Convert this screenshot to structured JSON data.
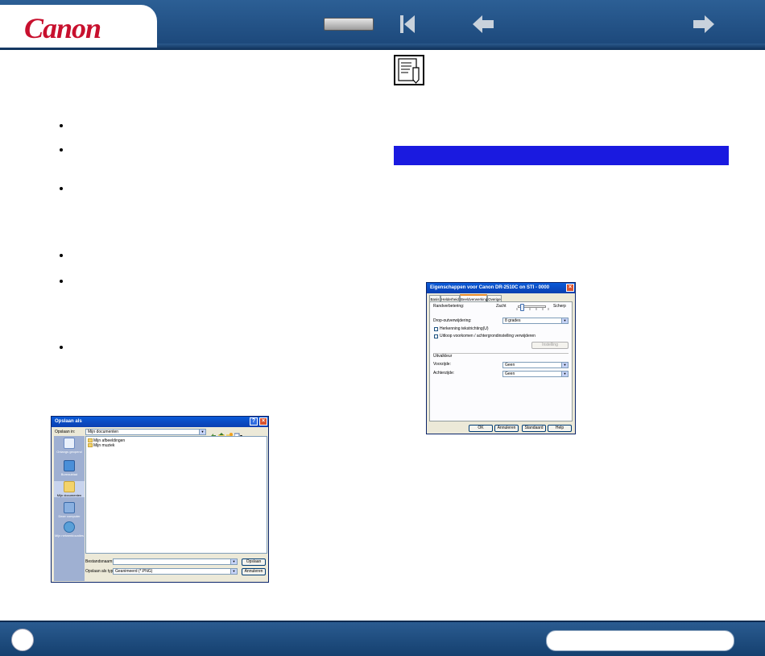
{
  "header": {
    "logo": "Canon",
    "nav": {
      "first_icon": "first-page-icon",
      "prev_icon": "arrow-left-icon",
      "next_icon": "arrow-right-icon"
    }
  },
  "save_dialog": {
    "title": "Opslaan als",
    "look_in_label": "Opslaan in:",
    "look_in_value": "Mijn documenten",
    "places": [
      "Onlangs geopend",
      "Bureaublad",
      "Mijn documenten",
      "Deze computer",
      "Mijn netwerklocaties"
    ],
    "files": [
      "Mijn afbeeldingen",
      "Mijn muziek"
    ],
    "filename_label": "Bestandsnaam:",
    "filetype_label": "Opslaan als type:",
    "filetype_value": "Geanimeerd (*.PNG)",
    "save_button": "Opslaan",
    "cancel_button": "Annuleren"
  },
  "properties_dialog": {
    "title": "Eigenschappen voor Canon DR-2510C on STI - 0000",
    "tabs": [
      "Basis",
      "Helderheid",
      "Beeldverwerking",
      "Overige"
    ],
    "edge_label": "Randverbetering:",
    "smooth_label": "Zacht",
    "sharp_label": "Scherp",
    "sharpness_level": 0.1,
    "dropout_label": "Drop-outverwijdering:",
    "dropout_value": "8 grades",
    "checkbox1": "Herkenning tekstrichting(U)",
    "checkbox2": "Uitloop voorkomen / achtergrondinstelling verwijderen",
    "settings_button": "Instelling",
    "color_dropout_label": "Uitvalkleur",
    "front_label": "Voorzijde:",
    "front_value": "Geen",
    "back_label": "Achterzijde:",
    "back_value": "Geen",
    "ok_button": "OK",
    "cancel_button": "Annuleren",
    "standard_button": "Standaard",
    "help_button": "Help"
  }
}
